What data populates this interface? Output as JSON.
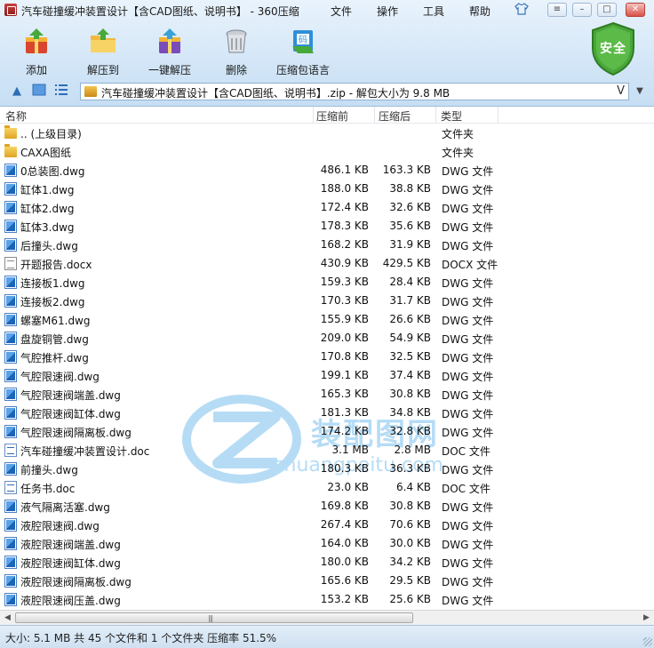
{
  "window": {
    "title": "汽车碰撞缓冲装置设计【含CAD图纸、说明书】 - 360压缩",
    "menu": [
      "文件",
      "操作",
      "工具",
      "帮助"
    ],
    "controls": [
      "shirt-icon",
      "menu-icon",
      "minimize-icon",
      "maximize-icon",
      "close-icon"
    ]
  },
  "toolbar": {
    "buttons": [
      {
        "label": "添加",
        "icon": "add-archive-icon"
      },
      {
        "label": "解压到",
        "icon": "extract-folder-icon"
      },
      {
        "label": "一键解压",
        "icon": "one-click-extract-icon"
      },
      {
        "label": "删除",
        "icon": "trash-icon"
      },
      {
        "label": "压缩包语言",
        "icon": "archive-language-icon"
      }
    ],
    "security_badge": "安全"
  },
  "navbar": {
    "path": "汽车碰撞缓冲装置设计【含CAD图纸、说明书】.zip - 解包大小为 9.8 MB",
    "path_suffix": "V"
  },
  "columns": {
    "name": "名称",
    "original": "压缩前",
    "compressed": "压缩后",
    "type": "类型"
  },
  "files": [
    {
      "name": ".. (上级目录)",
      "original": "",
      "compressed": "",
      "type": "文件夹",
      "icon": "folder"
    },
    {
      "name": "CAXA图纸",
      "original": "",
      "compressed": "",
      "type": "文件夹",
      "icon": "folder"
    },
    {
      "name": "0总装图.dwg",
      "original": "486.1 KB",
      "compressed": "163.3 KB",
      "type": "DWG 文件",
      "icon": "dwg"
    },
    {
      "name": "缸体1.dwg",
      "original": "188.0 KB",
      "compressed": "38.8 KB",
      "type": "DWG 文件",
      "icon": "dwg"
    },
    {
      "name": "缸体2.dwg",
      "original": "172.4 KB",
      "compressed": "32.6 KB",
      "type": "DWG 文件",
      "icon": "dwg"
    },
    {
      "name": "缸体3.dwg",
      "original": "178.3 KB",
      "compressed": "35.6 KB",
      "type": "DWG 文件",
      "icon": "dwg"
    },
    {
      "name": "后撞头.dwg",
      "original": "168.2 KB",
      "compressed": "31.9 KB",
      "type": "DWG 文件",
      "icon": "dwg"
    },
    {
      "name": "开题报告.docx",
      "original": "430.9 KB",
      "compressed": "429.5 KB",
      "type": "DOCX 文件",
      "icon": "docx"
    },
    {
      "name": "连接板1.dwg",
      "original": "159.3 KB",
      "compressed": "28.4 KB",
      "type": "DWG 文件",
      "icon": "dwg"
    },
    {
      "name": "连接板2.dwg",
      "original": "170.3 KB",
      "compressed": "31.7 KB",
      "type": "DWG 文件",
      "icon": "dwg"
    },
    {
      "name": "螺塞M61.dwg",
      "original": "155.9 KB",
      "compressed": "26.6 KB",
      "type": "DWG 文件",
      "icon": "dwg"
    },
    {
      "name": "盘旋铜管.dwg",
      "original": "209.0 KB",
      "compressed": "54.9 KB",
      "type": "DWG 文件",
      "icon": "dwg"
    },
    {
      "name": "气腔推杆.dwg",
      "original": "170.8 KB",
      "compressed": "32.5 KB",
      "type": "DWG 文件",
      "icon": "dwg"
    },
    {
      "name": "气腔限速阀.dwg",
      "original": "199.1 KB",
      "compressed": "37.4 KB",
      "type": "DWG 文件",
      "icon": "dwg"
    },
    {
      "name": "气腔限速阀端盖.dwg",
      "original": "165.3 KB",
      "compressed": "30.8 KB",
      "type": "DWG 文件",
      "icon": "dwg"
    },
    {
      "name": "气腔限速阀缸体.dwg",
      "original": "181.3 KB",
      "compressed": "34.8 KB",
      "type": "DWG 文件",
      "icon": "dwg"
    },
    {
      "name": "气腔限速阀隔离板.dwg",
      "original": "174.2 KB",
      "compressed": "32.8 KB",
      "type": "DWG 文件",
      "icon": "dwg"
    },
    {
      "name": "汽车碰撞缓冲装置设计.doc",
      "original": "3.1 MB",
      "compressed": "2.8 MB",
      "type": "DOC 文件",
      "icon": "doc"
    },
    {
      "name": "前撞头.dwg",
      "original": "180.3 KB",
      "compressed": "36.3 KB",
      "type": "DWG 文件",
      "icon": "dwg"
    },
    {
      "name": "任务书.doc",
      "original": "23.0 KB",
      "compressed": "6.4 KB",
      "type": "DOC 文件",
      "icon": "doc"
    },
    {
      "name": "液气隔离活塞.dwg",
      "original": "169.8 KB",
      "compressed": "30.8 KB",
      "type": "DWG 文件",
      "icon": "dwg"
    },
    {
      "name": "液腔限速阀.dwg",
      "original": "267.4 KB",
      "compressed": "70.6 KB",
      "type": "DWG 文件",
      "icon": "dwg"
    },
    {
      "name": "液腔限速阀端盖.dwg",
      "original": "164.0 KB",
      "compressed": "30.0 KB",
      "type": "DWG 文件",
      "icon": "dwg"
    },
    {
      "name": "液腔限速阀缸体.dwg",
      "original": "180.0 KB",
      "compressed": "34.2 KB",
      "type": "DWG 文件",
      "icon": "dwg"
    },
    {
      "name": "液腔限速阀隔离板.dwg",
      "original": "165.6 KB",
      "compressed": "29.5 KB",
      "type": "DWG 文件",
      "icon": "dwg"
    },
    {
      "name": "液腔限速阀压盖.dwg",
      "original": "153.2 KB",
      "compressed": "25.6 KB",
      "type": "DWG 文件",
      "icon": "dwg"
    }
  ],
  "watermark": {
    "cn": "装配图网",
    "en": "zhuangpeitu.com"
  },
  "status": "大小: 5.1 MB 共 45 个文件和 1 个文件夹 压缩率 51.5%",
  "colors": {
    "accent": "#2f6eb6",
    "chrome_top": "#e9f3fc",
    "chrome_bottom": "#c6def4",
    "shield": "#4aa63a"
  }
}
